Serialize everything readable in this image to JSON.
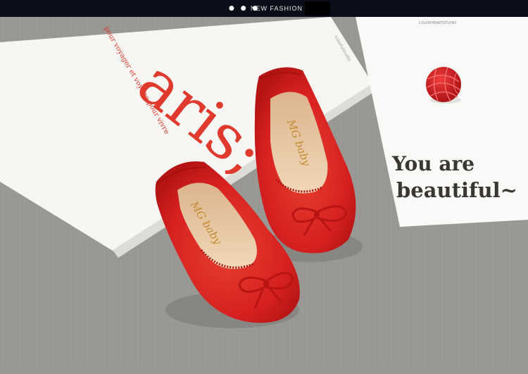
{
  "header": {
    "dots": "● ● ●",
    "title": "NEW FASHION"
  },
  "scene": {
    "book_big_text": "aris;",
    "book_side_text": "pour voyager et voyage pour vivre",
    "book_small_text": "colorfulstudio",
    "card_small_text": "COLORHEARTSTUDIO",
    "card_text_line1": "You are",
    "card_text_line2": "beautiful~",
    "insole_brand_left": "MG baby",
    "insole_brand_right": "MG baby"
  },
  "colors": {
    "topbar": "#0b0f1a",
    "floor": "#9a9894",
    "shoe_red": "#d92323",
    "paper": "#f7f6f3",
    "insole": "#e8c9a5",
    "book_text": "#e0392e"
  }
}
